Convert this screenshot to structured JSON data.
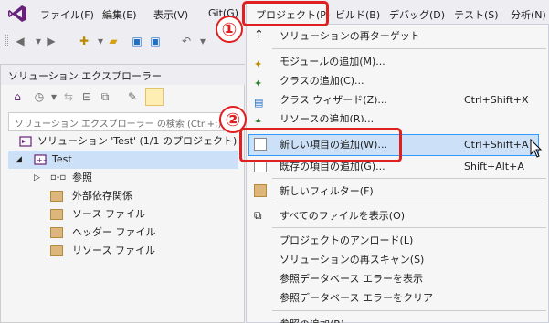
{
  "menubar": {
    "items": [
      "ファイル(F)",
      "編集(E)",
      "表示(V)",
      "Git(G)",
      "プロジェクト(P)",
      "ビルド(B)",
      "デバッグ(D)",
      "テスト(S)",
      "分析(N)"
    ]
  },
  "solution_explorer": {
    "title": "ソリューション エクスプローラー",
    "search_placeholder": "ソリューション エクスプローラー の検索 (Ctrl+;)",
    "solution_label": "ソリューション 'Test' (1/1 のプロジェクト)",
    "project_label": "Test",
    "nodes": [
      "参照",
      "外部依存関係",
      "ソース ファイル",
      "ヘッダー ファイル",
      "リソース ファイル"
    ]
  },
  "project_menu": {
    "items": [
      {
        "label": "ソリューションの再ターゲット",
        "shortcut": ""
      },
      {
        "label": "モジュールの追加(M)...",
        "shortcut": ""
      },
      {
        "label": "クラスの追加(C)...",
        "shortcut": ""
      },
      {
        "label": "クラス ウィザード(Z)...",
        "shortcut": "Ctrl+Shift+X"
      },
      {
        "label": "リソースの追加(R)...",
        "shortcut": ""
      },
      {
        "label": "新しい項目の追加(W)...",
        "shortcut": "Ctrl+Shift+A"
      },
      {
        "label": "既存の項目の追加(G)...",
        "shortcut": "Shift+Alt+A"
      },
      {
        "label": "新しいフィルター(F)",
        "shortcut": ""
      },
      {
        "label": "すべてのファイルを表示(O)",
        "shortcut": ""
      },
      {
        "label": "プロジェクトのアンロード(L)",
        "shortcut": ""
      },
      {
        "label": "ソリューションの再スキャン(S)",
        "shortcut": ""
      },
      {
        "label": "参照データベース エラーを表示",
        "shortcut": ""
      },
      {
        "label": "参照データベース エラーをクリア",
        "shortcut": ""
      },
      {
        "label": "参照の追加(R)...",
        "shortcut": ""
      }
    ]
  },
  "annotations": {
    "step1": "①",
    "step2": "②"
  },
  "colors": {
    "accent": "#68217a",
    "highlight_bg": "#cce0f7",
    "highlight_border": "#3399ff",
    "annotation_red": "#e02020"
  }
}
